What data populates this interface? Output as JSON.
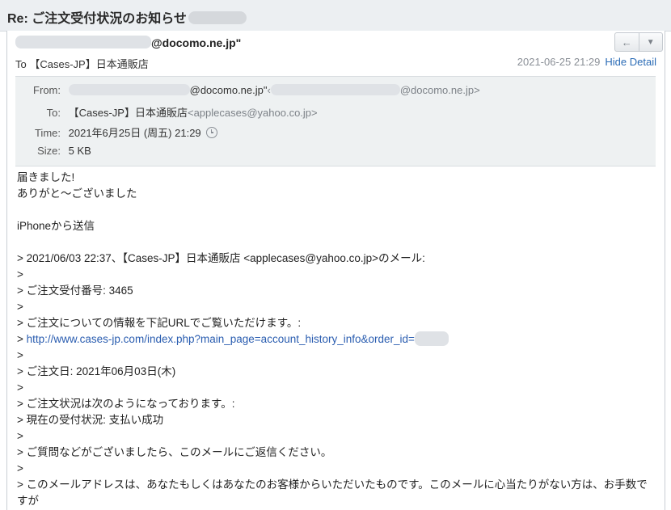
{
  "subject": "Re: ご注文受付状況のお知らせ",
  "sender": {
    "address_suffix": "@docomo.ne.jp\""
  },
  "buttons": {
    "reply": "←",
    "more": "▼"
  },
  "to_line": {
    "label": "To",
    "name": "【Cases-JP】日本通販店"
  },
  "date_line": {
    "datetime": "2021-06-25 21:29",
    "hide_detail": "Hide Detail"
  },
  "detail": {
    "from_label": "From:",
    "from_part1": "@docomo.ne.jp\"",
    "from_part2": "@docomo.ne.jp>",
    "to_label": "To:",
    "to_name": "【Cases-JP】日本通販店",
    "to_email": "<applecases@yahoo.co.jp>",
    "time_label": "Time:",
    "time_value": "2021年6月25日 (周五) 21:29",
    "size_label": "Size:",
    "size_value": "5 KB"
  },
  "body": {
    "lines": [
      "届きました!",
      "ありがと～ございました",
      "",
      "iPhoneから送信",
      "",
      "> 2021/06/03 22:37、【Cases-JP】日本通販店 <applecases@yahoo.co.jp>のメール:",
      ">",
      "> ご注文受付番号: 3465",
      ">",
      "> ご注文についての情報を下記URLでご覧いただけます。:"
    ],
    "link_prefix": "> ",
    "link": "http://www.cases-jp.com/index.php?main_page=account_history_info&order_id=",
    "lines2": [
      ">",
      "> ご注文日: 2021年06月03日(木)",
      ">",
      "> ご注文状況は次のようになっております。:",
      "> 現在の受付状況: 支払い成功",
      ">",
      "> ご質問などがございましたら、このメールにご返信ください。",
      ">",
      "> このメールアドレスは、あなたもしくはあなたのお客様からいただいたものです。このメールに心当たりがない方は、お手数ですが"
    ]
  }
}
